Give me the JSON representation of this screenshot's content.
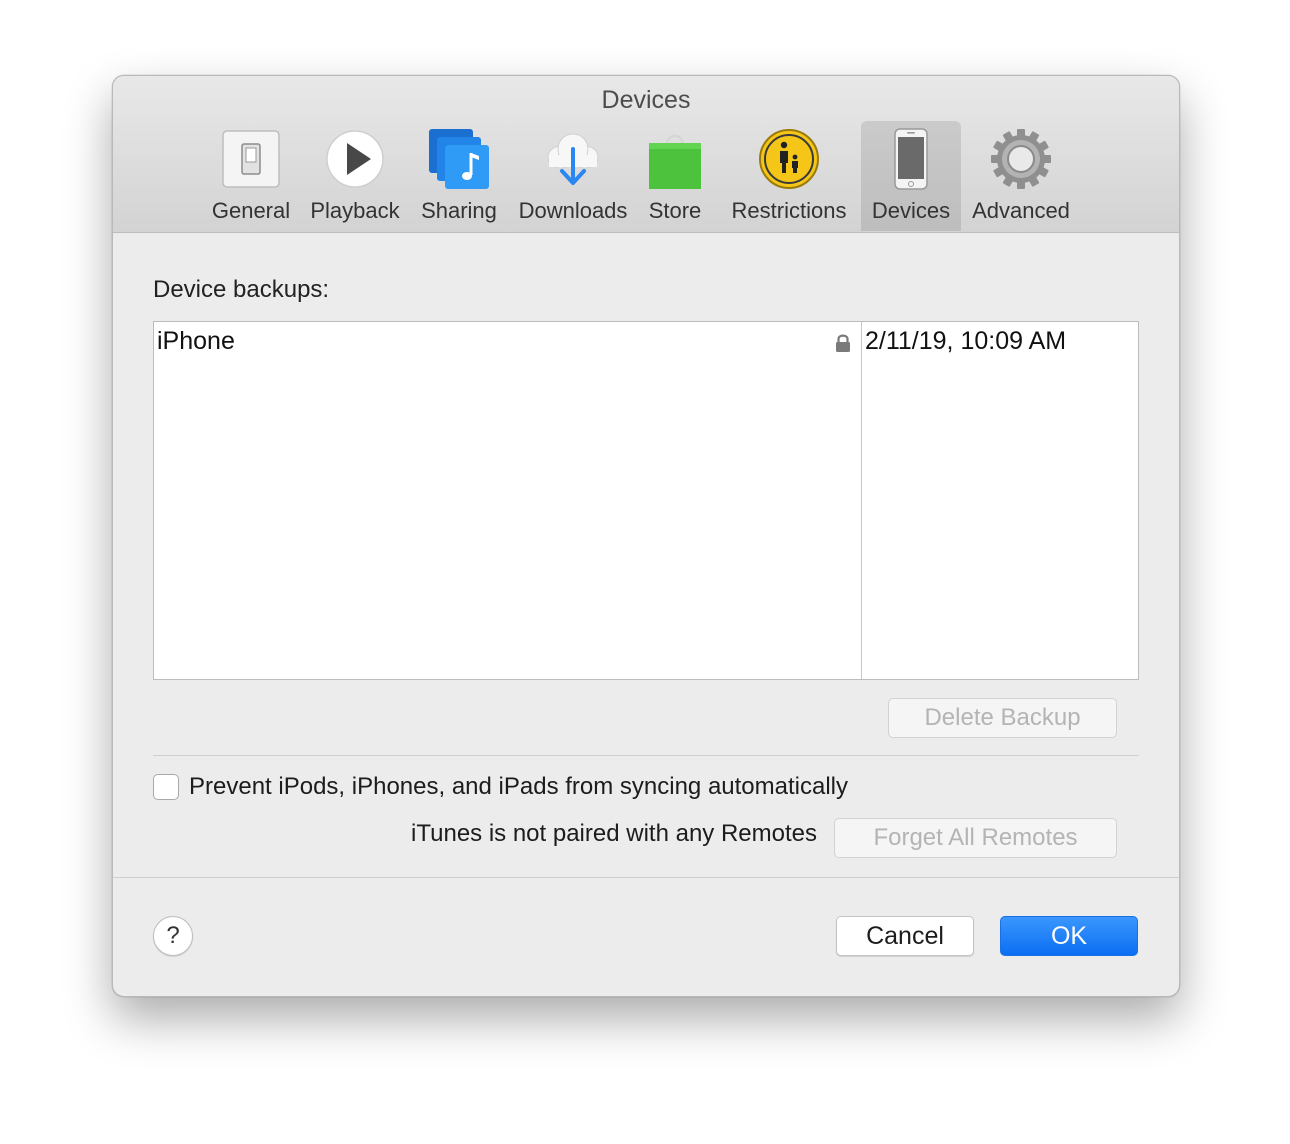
{
  "window": {
    "title": "Devices"
  },
  "toolbar": {
    "items": [
      {
        "label": "General",
        "icon": "general-switch-icon",
        "selected": false
      },
      {
        "label": "Playback",
        "icon": "play-icon",
        "selected": false
      },
      {
        "label": "Sharing",
        "icon": "sharing-music-icon",
        "selected": false
      },
      {
        "label": "Downloads",
        "icon": "cloud-download-icon",
        "selected": false
      },
      {
        "label": "Store",
        "icon": "shopping-bag-icon",
        "selected": false
      },
      {
        "label": "Restrictions",
        "icon": "parental-controls-icon",
        "selected": false
      },
      {
        "label": "Devices",
        "icon": "iphone-icon",
        "selected": true
      },
      {
        "label": "Advanced",
        "icon": "gear-icon",
        "selected": false
      }
    ]
  },
  "backups": {
    "section_label": "Device backups:",
    "rows": [
      {
        "name": "iPhone",
        "locked": true,
        "date": "2/11/19, 10:09 AM"
      }
    ],
    "delete_button": "Delete Backup"
  },
  "sync": {
    "prevent_label": "Prevent iPods, iPhones, and iPads from syncing automatically",
    "prevent_checked": false
  },
  "remotes": {
    "status_text": "iTunes is not paired with any Remotes",
    "forget_button": "Forget All Remotes"
  },
  "footer": {
    "help_label": "?",
    "cancel_label": "Cancel",
    "ok_label": "OK"
  },
  "colors": {
    "accent": "#0b6ef2",
    "window_bg": "#ececec",
    "disabled_text": "#b4b4b4"
  }
}
